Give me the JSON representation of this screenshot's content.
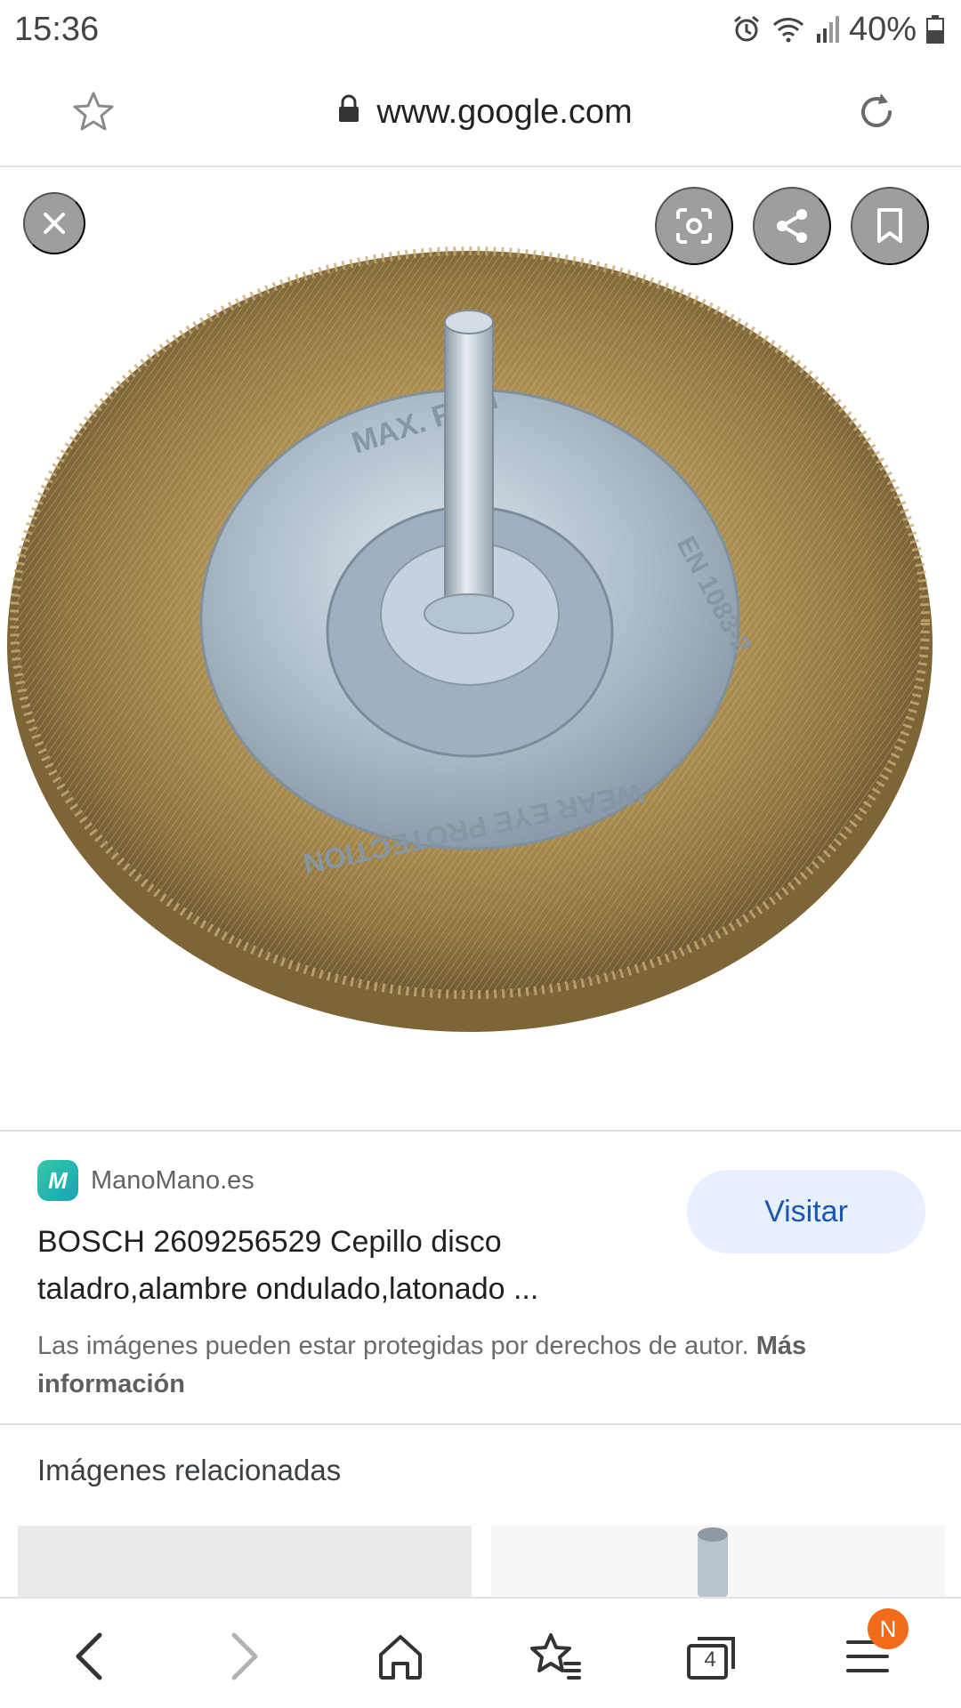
{
  "status_bar": {
    "time": "15:36",
    "battery": "40%",
    "icons": [
      "alarm-icon",
      "wifi-icon",
      "signal-icon",
      "battery-icon"
    ]
  },
  "url_bar": {
    "url": "www.google.com",
    "icons": [
      "star-icon",
      "lock-icon",
      "reload-icon"
    ]
  },
  "viewer": {
    "actions": [
      "close-icon",
      "lens-icon",
      "share-icon",
      "bookmark-icon"
    ],
    "product_image": {
      "subject": "brass wire wheel brush with shaft",
      "disc_text_top": "MAX. RPM",
      "disc_text_right": "EN 1083-2",
      "disc_text_bottom": "WEAR EYE PROTECTION"
    }
  },
  "result": {
    "source_logo_letter": "M",
    "source_name": "ManoMano.es",
    "title": "BOSCH 2609256529 Cepillo disco taladro,alambre ondulado,latonado ...",
    "visit_label": "Visitar",
    "copyright_text": "Las imágenes pueden estar protegidas por derechos de autor.",
    "copyright_link": "Más información"
  },
  "related": {
    "title": "Imágenes relacionadas"
  },
  "bottom_nav": {
    "items": [
      "back-icon",
      "forward-icon",
      "home-icon",
      "bookmarks-icon",
      "tabs-icon",
      "menu-icon"
    ],
    "tabs_count": "4",
    "menu_badge": "N"
  },
  "colors": {
    "accent_blue": "#1a56b7",
    "visit_bg": "#e8f0fe",
    "badge_orange": "#f26b1d",
    "brass": "#b89a5c"
  }
}
